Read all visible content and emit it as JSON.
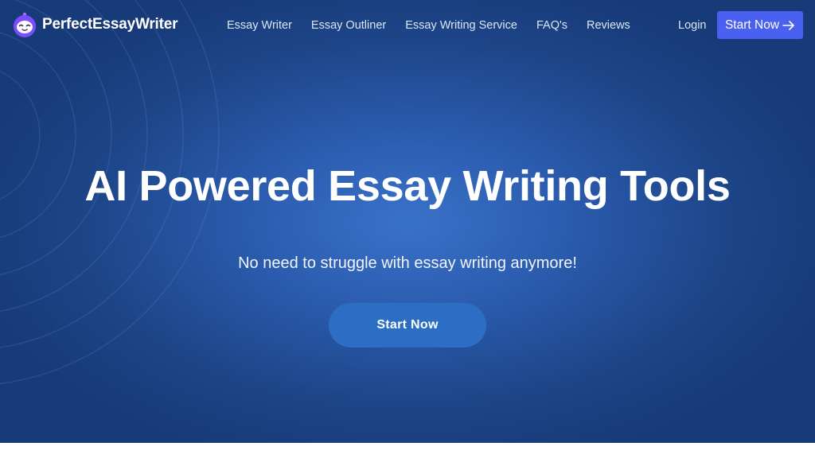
{
  "brand": {
    "name": "PerfectEssayWriter",
    "icon": "robot-face-icon",
    "icon_color": "#7b4dff"
  },
  "nav": {
    "links": [
      {
        "label": "Essay Writer"
      },
      {
        "label": "Essay Outliner"
      },
      {
        "label": "Essay Writing Service"
      },
      {
        "label": "FAQ's"
      },
      {
        "label": "Reviews"
      }
    ],
    "login_label": "Login",
    "cta_label": "Start Now",
    "cta_icon": "arrow-right-icon",
    "cta_color": "#4a60f0"
  },
  "hero": {
    "headline": "AI Powered Essay Writing Tools",
    "subheadline": "No need to struggle with essay writing anymore!",
    "cta_label": "Start Now",
    "cta_color": "#2d6ec5",
    "background_color": "#1d4588"
  }
}
